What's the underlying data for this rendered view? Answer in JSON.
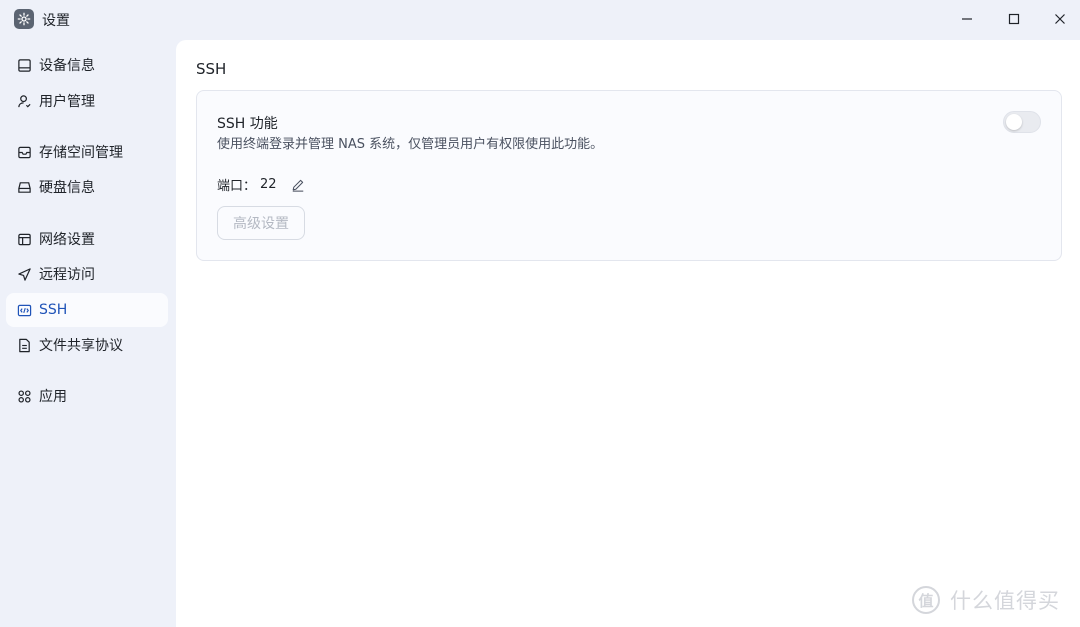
{
  "window": {
    "title": "设置",
    "icon": "gear-icon"
  },
  "sidebar": {
    "items": [
      {
        "label": "设备信息",
        "icon": "device-icon",
        "active": false
      },
      {
        "label": "用户管理",
        "icon": "user-icon",
        "active": false
      },
      {
        "label": "存储空间管理",
        "icon": "storage-icon",
        "active": false
      },
      {
        "label": "硬盘信息",
        "icon": "disk-icon",
        "active": false
      },
      {
        "label": "网络设置",
        "icon": "network-icon",
        "active": false
      },
      {
        "label": "远程访问",
        "icon": "send-icon",
        "active": false
      },
      {
        "label": "SSH",
        "icon": "code-icon",
        "active": true
      },
      {
        "label": "文件共享协议",
        "icon": "file-icon",
        "active": false
      },
      {
        "label": "应用",
        "icon": "apps-icon",
        "active": false
      }
    ]
  },
  "main": {
    "page_title": "SSH",
    "card": {
      "title": "SSH 功能",
      "description": "使用终端登录并管理 NAS 系统，仅管理员用户有权限使用此功能。",
      "toggle_on": false,
      "port_label": "端口：",
      "port_value": "22",
      "advanced_button": "高级设置"
    }
  },
  "watermark": {
    "symbol": "值",
    "text": "什么值得买"
  },
  "colors": {
    "background": "#eef1f9",
    "active_text": "#1f53b8",
    "panel": "#ffffff"
  }
}
